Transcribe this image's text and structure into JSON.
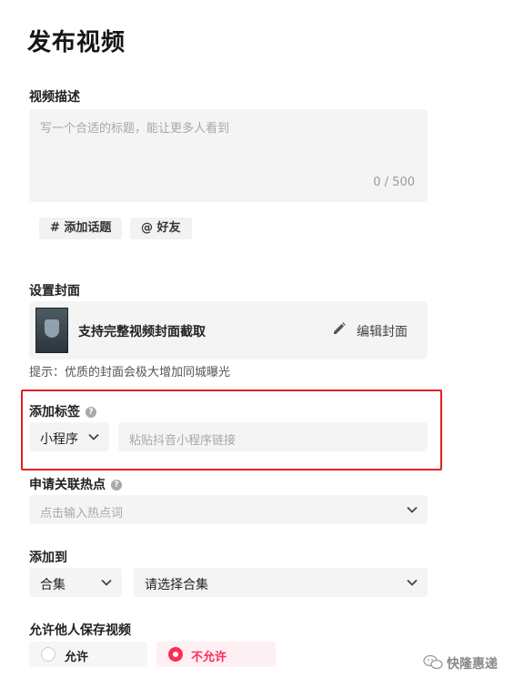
{
  "page": {
    "title": "发布视频"
  },
  "description": {
    "label": "视频描述",
    "placeholder": "写一个合适的标题，能让更多人看到",
    "counter": "0 / 500",
    "topic_button": "# 添加话题",
    "friend_button": "@ 好友"
  },
  "cover": {
    "label": "设置封面",
    "caption": "支持完整视频封面截取",
    "edit_button": "编辑封面",
    "hint": "提示：优质的封面会极大增加同城曝光"
  },
  "tag": {
    "label": "添加标签",
    "help_icon": "?",
    "type_value": "小程序",
    "link_placeholder": "粘贴抖音小程序链接"
  },
  "hotspot": {
    "label": "申请关联热点",
    "help_icon": "?",
    "placeholder": "点击输入热点词"
  },
  "add_to": {
    "label": "添加到",
    "type_value": "合集",
    "collection_placeholder": "请选择合集"
  },
  "save_permission": {
    "label": "允许他人保存视频",
    "options": [
      {
        "label": "允许",
        "selected": false
      },
      {
        "label": "不允许",
        "selected": true
      }
    ]
  },
  "watermark": {
    "text": "快隆惠递"
  },
  "colors": {
    "accent": "#fe2c55",
    "highlight_frame": "#e02020"
  }
}
